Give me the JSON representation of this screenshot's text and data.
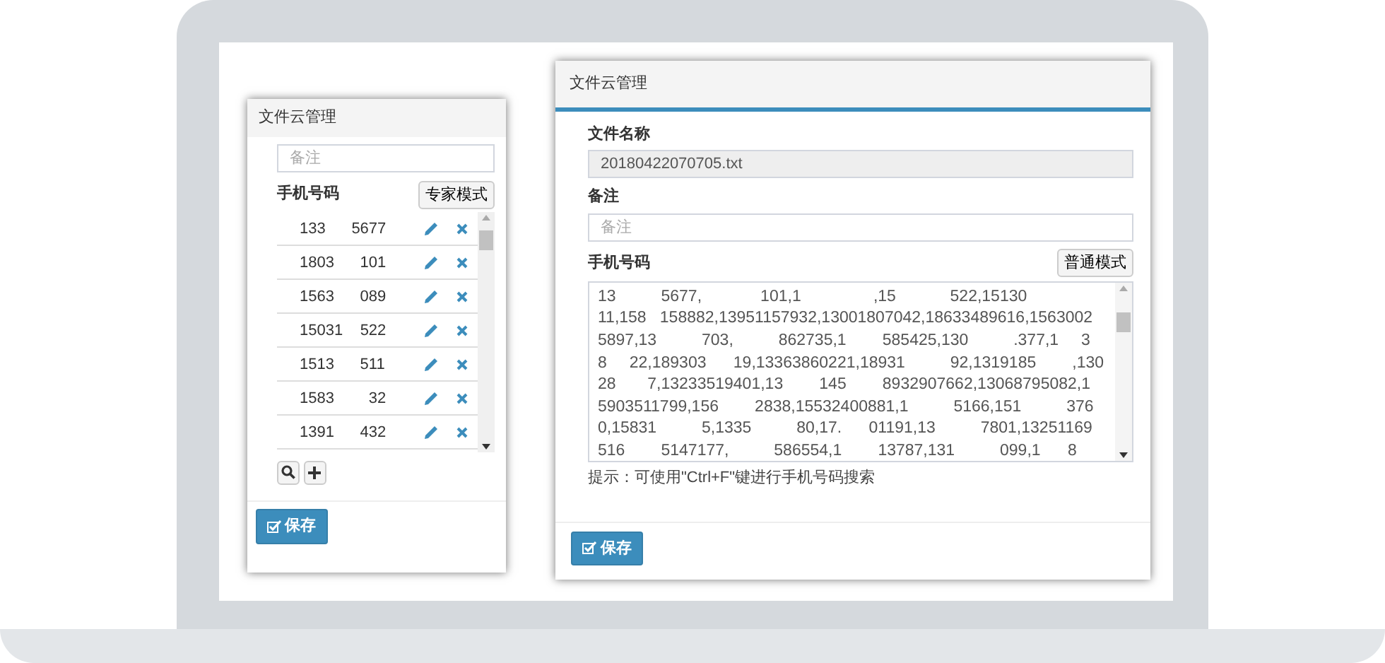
{
  "left_dialog": {
    "title": "文件云管理",
    "remark_field": {
      "placeholder": "备注"
    },
    "phone_label": "手机号码",
    "mode_button": "专家模式",
    "phone_list": [
      {
        "number": "133      5677"
      },
      {
        "number": "1803      101"
      },
      {
        "number": "1563      089"
      },
      {
        "number": "15031    522"
      },
      {
        "number": "1513      511"
      },
      {
        "number": "1583        32"
      },
      {
        "number": "1391      432"
      }
    ],
    "save_button": "保存"
  },
  "right_dialog": {
    "title": "文件云管理",
    "file_name_label": "文件名称",
    "file_name_value": "20180422070705.txt",
    "remark_label": "备注",
    "remark_field": {
      "placeholder": "备注"
    },
    "phone_label": "手机号码",
    "mode_button": "普通模式",
    "phone_numbers_lines": [
      "13          5677,             101,1                ,15            522,15130",
      "11,158   158882,13951157932,13001807042,18633489616,1563002",
      "5897,13          703,          862735,1        585425,130          .377,1     3",
      "8     22,189303      19,13363860221,18931          92,1319185        ,130",
      "28       7,13233519401,13        145        8932907662,13068795082,1",
      "5903511799,156        2838,15532400881,1          5166,151          376",
      "0,15831          5,1335          80,17.      01191,13          7801,13251169",
      "516        5147177,          586554,1        13787,131          099,1      8"
    ],
    "hint": "提示：可使用\"Ctrl+F\"键进行手机号码搜索",
    "save_button": "保存"
  }
}
